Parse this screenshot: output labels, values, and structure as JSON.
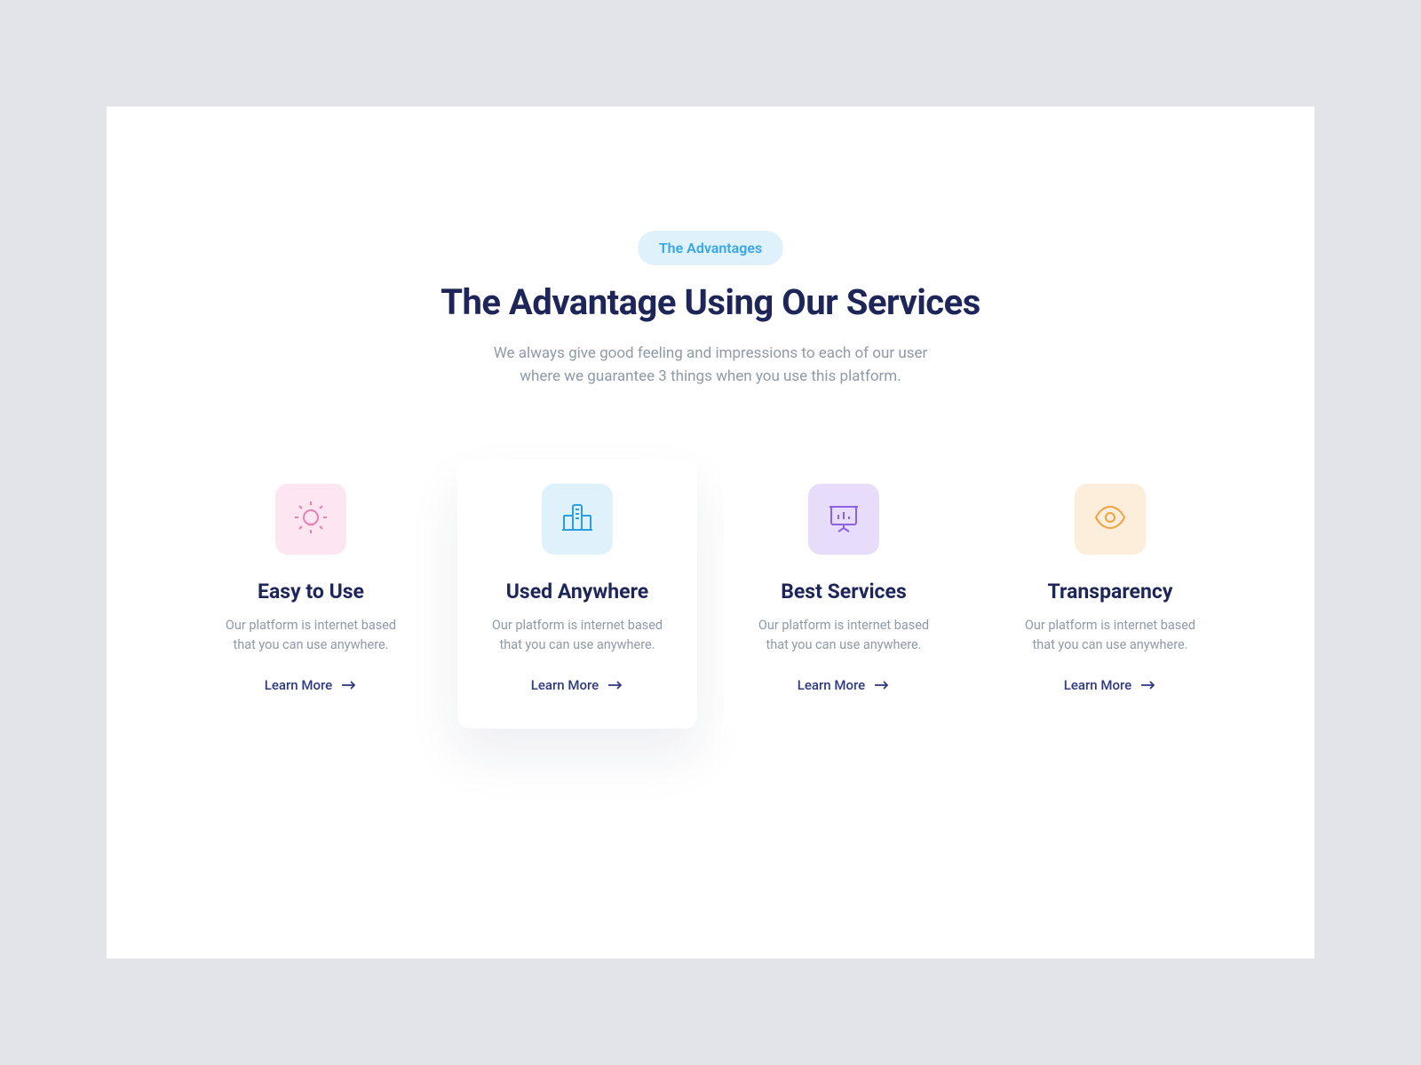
{
  "header": {
    "badge": "The Advantages",
    "title": "The Advantage Using Our Services",
    "subtitle": "We always give good feeling and impressions to each of our user\nwhere we guarantee 3 things when you use this platform."
  },
  "cards": [
    {
      "icon": "lightbulb-icon",
      "icon_color": "#ea7fb5",
      "box_class": "pink",
      "title": "Easy to Use",
      "description": "Our platform is internet based\nthat you can use anywhere.",
      "cta": "Learn More",
      "elevated": false
    },
    {
      "icon": "buildings-icon",
      "icon_color": "#2b9fe0",
      "box_class": "blue",
      "title": "Used Anywhere",
      "description": "Our platform is internet based\nthat you can use anywhere.",
      "cta": "Learn More",
      "elevated": true
    },
    {
      "icon": "presentation-icon",
      "icon_color": "#8d61e6",
      "box_class": "purple",
      "title": "Best Services",
      "description": "Our platform is internet based\nthat you can use anywhere.",
      "cta": "Learn More",
      "elevated": false
    },
    {
      "icon": "eye-icon",
      "icon_color": "#f0a23e",
      "box_class": "orange",
      "title": "Transparency",
      "description": "Our platform is internet based\nthat you can use anywhere.",
      "cta": "Learn More",
      "elevated": false
    }
  ]
}
